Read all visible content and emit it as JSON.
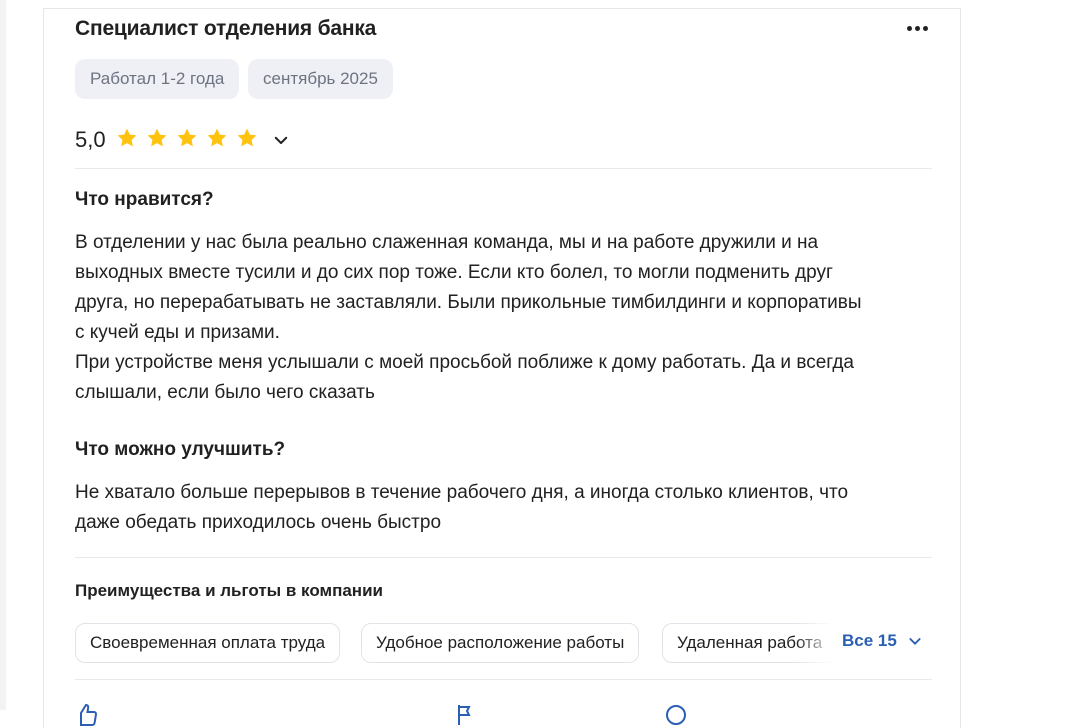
{
  "review": {
    "title": "Специалист отделения банка",
    "tags": [
      "Работал 1-2 года",
      "сентябрь 2025"
    ],
    "rating": "5,0",
    "stars": 5,
    "star_color": "#ffc20f",
    "likes_heading": "Что нравится?",
    "likes_text": "В отделении у нас была реально слаженная команда, мы и на работе дружили и на\nвыходных вместе тусили и до сих пор тоже. Если кто болел, то могли подменить друг\nдруга, но перерабатывать не заставляли. Были прикольные тимбилдинги и корпоративы\nс кучей еды и призами.\nПри устройстве меня услышали с моей просьбой поближе к дому работать. Да и всегда\nслышали, если было чего сказать",
    "improve_heading": "Что можно улучшить?",
    "improve_text": "Не хватало больше перерывов в течение рабочего дня, а иногда столько клиентов, что\nдаже обедать приходилось очень быстро"
  },
  "benefits": {
    "heading": "Преимущества и льготы в компании",
    "chips": [
      "Своевременная оплата труда",
      "Удобное расположение работы",
      "Удаленная работа"
    ],
    "all_label": "Все 15",
    "accent_color": "#2b5fb3"
  },
  "icons": [
    "more-horizontal-icon",
    "star-icon",
    "chevron-down-icon",
    "like-icon",
    "thumb-icon",
    "comment-icon"
  ]
}
